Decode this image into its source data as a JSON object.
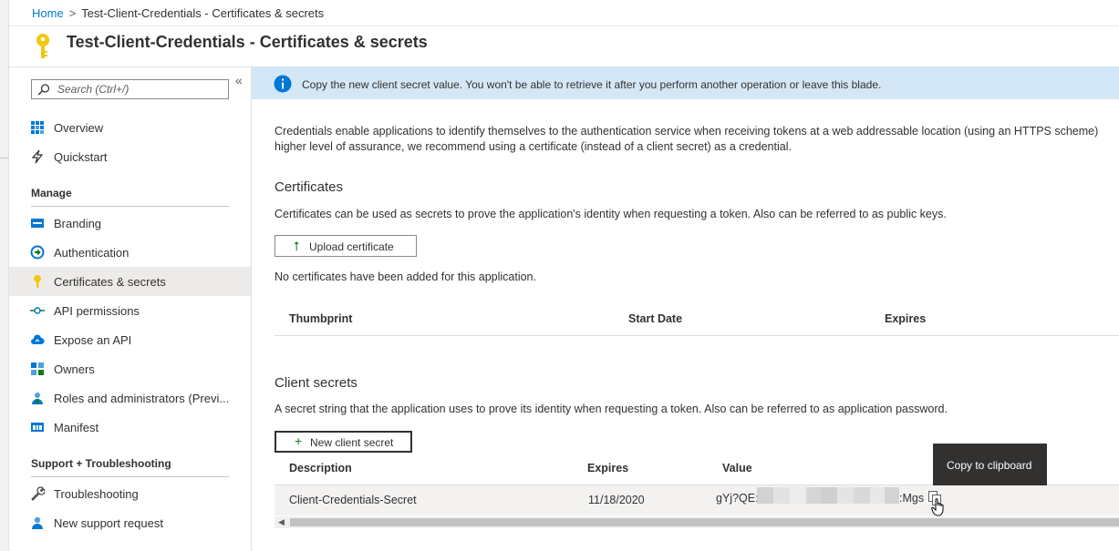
{
  "breadcrumb": {
    "home": "Home",
    "separator": ">",
    "current": "Test-Client-Credentials - Certificates & secrets"
  },
  "page": {
    "title": "Test-Client-Credentials - Certificates & secrets",
    "icon": "key-icon"
  },
  "sidebar": {
    "search_placeholder": "Search (Ctrl+/)",
    "collapse_label": "«",
    "items": [
      {
        "label": "Overview",
        "icon": "overview-grid-icon"
      },
      {
        "label": "Quickstart",
        "icon": "lightning-icon"
      }
    ],
    "manage_heading": "Manage",
    "manage_items": [
      {
        "label": "Branding",
        "icon": "branding-icon"
      },
      {
        "label": "Authentication",
        "icon": "authentication-icon"
      },
      {
        "label": "Certificates & secrets",
        "icon": "key-icon",
        "active": true
      },
      {
        "label": "API permissions",
        "icon": "api-permissions-icon"
      },
      {
        "label": "Expose an API",
        "icon": "cloud-icon"
      },
      {
        "label": "Owners",
        "icon": "owners-icon"
      },
      {
        "label": "Roles and administrators (Previ...",
        "icon": "roles-icon"
      },
      {
        "label": "Manifest",
        "icon": "manifest-icon"
      }
    ],
    "support_heading": "Support + Troubleshooting",
    "support_items": [
      {
        "label": "Troubleshooting",
        "icon": "wrench-icon"
      },
      {
        "label": "New support request",
        "icon": "support-person-icon"
      }
    ]
  },
  "banner": {
    "message": "Copy the new client secret value. You won't be able to retrieve it after you perform another operation or leave this blade."
  },
  "intro": {
    "line1": "Credentials enable applications to identify themselves to the authentication service when receiving tokens at a web addressable location (using an HTTPS scheme)",
    "line2": "higher level of assurance, we recommend using a certificate (instead of a client secret) as a credential."
  },
  "certificates": {
    "heading": "Certificates",
    "description": "Certificates can be used as secrets to prove the application's identity when requesting a token. Also can be referred to as public keys.",
    "upload_button": "Upload certificate",
    "empty_message": "No certificates have been added for this application.",
    "columns": [
      "Thumbprint",
      "Start Date",
      "Expires"
    ]
  },
  "client_secrets": {
    "heading": "Client secrets",
    "description": "A secret string that the application uses to prove its identity when requesting a token. Also can be referred to as application password.",
    "new_button": "New client secret",
    "columns": [
      "Description",
      "Expires",
      "Value"
    ],
    "rows": [
      {
        "description": "Client-Credentials-Secret",
        "expires": "11/18/2020",
        "value_prefix": "gYj?QE:",
        "value_suffix": ":Mgs"
      }
    ]
  },
  "tooltip": {
    "text": "Copy to clipboard"
  },
  "colors": {
    "accent": "#0078d4",
    "banner_bg": "#d4e7f7",
    "key_gold": "#f2c811",
    "tooltip_bg": "#323130"
  }
}
